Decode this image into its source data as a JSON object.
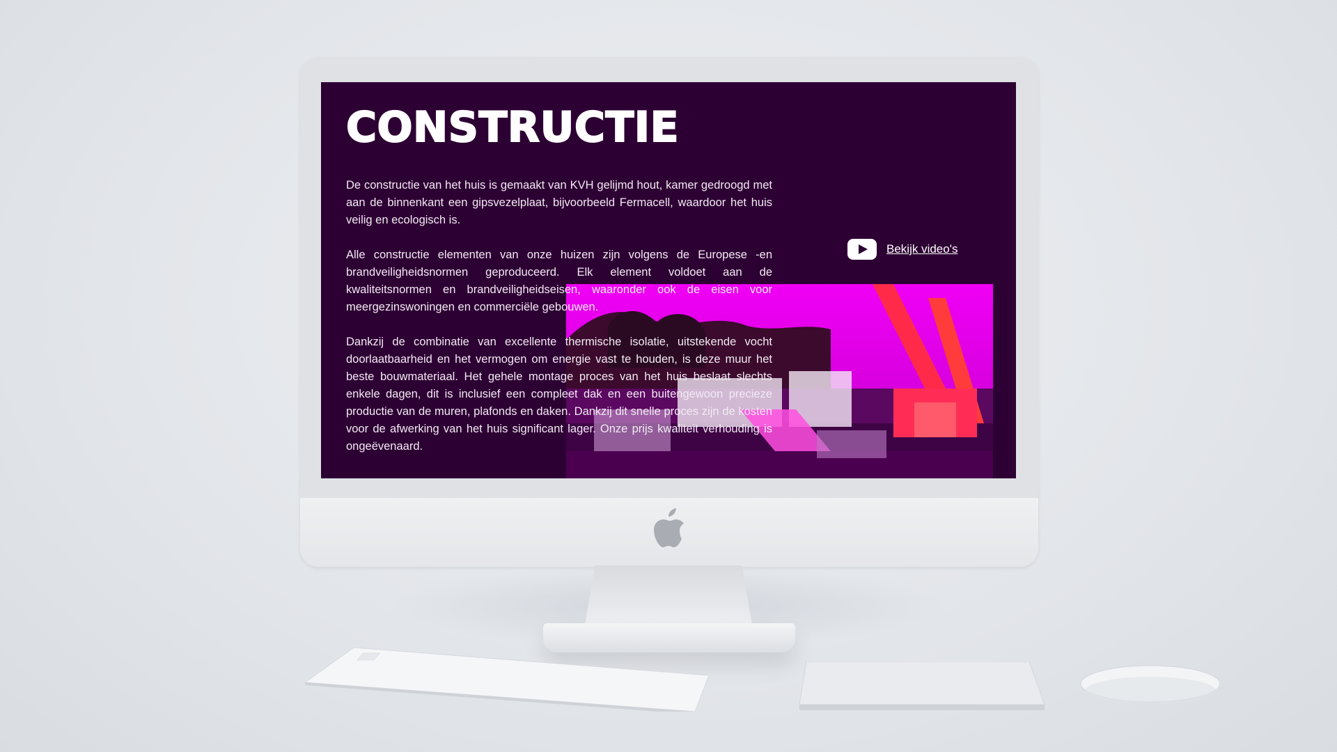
{
  "page": {
    "title": "CONSTRUCTIE",
    "paragraphs": [
      "De constructie van het huis is gemaakt van KVH gelijmd hout, kamer gedroogd met aan de binnenkant een gipsvezelplaat, bijvoorbeeld Fermacell, waardoor het huis veilig en ecologisch is.",
      "Alle constructie elementen van onze huizen zijn volgens de Europese -en brandveiligheidsnormen geproduceerd. Elk element voldoet aan de kwaliteitsnormen en brandveiligheidseisen, waaronder ook de eisen voor meergezinswoningen en commerciële gebouwen.",
      "Dankzij de combinatie van excellente thermische isolatie, uitstekende vocht doorlaatbaarheid en het vermogen om energie vast te houden, is deze muur het beste bouwmateriaal. Het gehele montage proces van het huis beslaat slechts enkele dagen, dit is inclusief een compleet dak en een buitengewoon precieze productie van de muren, plafonds en daken. Dankzij dit snelle proces zijn de kosten voor de afwerking van het huis significant lager. Onze prijs kwaliteit verhouding is ongeëvenaard."
    ],
    "video_link": {
      "label": "Bekijk video's",
      "icon": "youtube-play-icon"
    }
  },
  "colors": {
    "screen_background": "#2d0033",
    "photo_tint": "#e000e6",
    "text": "#ffffff"
  }
}
